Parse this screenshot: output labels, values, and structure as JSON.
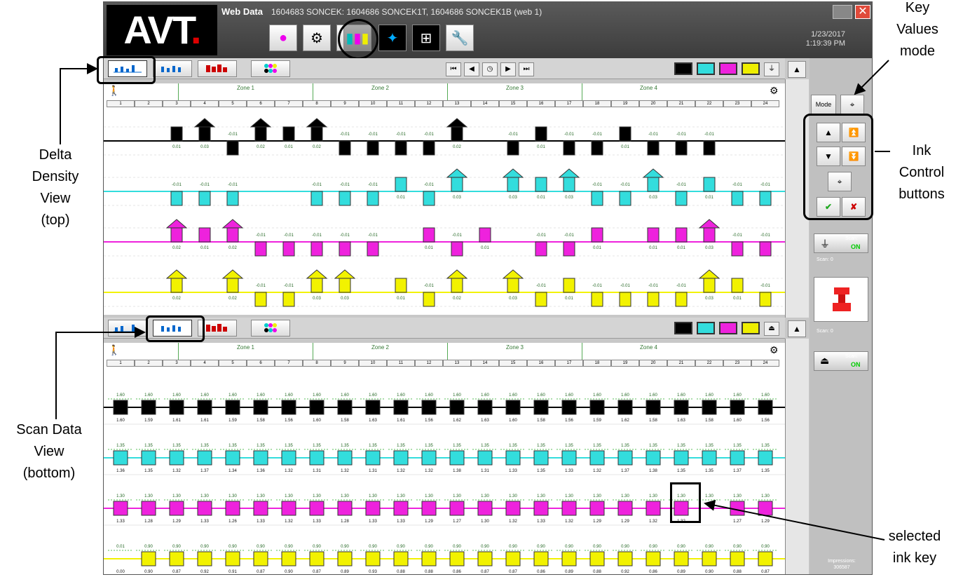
{
  "window": {
    "app_name": "Web Data",
    "job_title": "1604683 SONCEK: 1604686 SONCEK1T, 1604686 SONCEK1B  (web 1)",
    "date": "1/23/2017",
    "time": "1:19:39 PM",
    "logo": "AVT."
  },
  "toolbar_icons": [
    "colors-icon",
    "settings-icon",
    "monitor-icon",
    "chart-icon",
    "network-icon",
    "register-icon",
    "tools-icon"
  ],
  "zones": [
    "Zone 1",
    "Zone 2",
    "Zone 3",
    "Zone 4"
  ],
  "keys": [
    "1",
    "2",
    "3",
    "4",
    "5",
    "6",
    "7",
    "8",
    "9",
    "10",
    "11",
    "12",
    "13",
    "14",
    "15",
    "16",
    "17",
    "18",
    "19",
    "20",
    "21",
    "22",
    "23",
    "24"
  ],
  "side_panel": {
    "mode_label": "Mode",
    "scan_label": "Scan:",
    "scan_on": "ON",
    "scan_count_1": "Scan: 0",
    "scan_count_2": "Scan: 0",
    "impressions_label": "Impressions:",
    "impressions_value": "306587"
  },
  "annotations": {
    "key_values_mode": "Key\nValues\nmode",
    "ink_control": "Ink\nControl\nbuttons",
    "delta_density": "Delta\nDensity\nView\n(top)",
    "scan_data": "Scan Data\nView\n(bottom)",
    "selected_key": "selected\nink key"
  },
  "colors": {
    "black": "#000000",
    "cyan": "#33dddd",
    "magenta": "#ee22dd",
    "yellow": "#f2f200",
    "check": "#22aa22"
  },
  "delta_density": {
    "black": [
      "",
      "",
      "0.01",
      "0.03",
      "-0.01",
      "0.02",
      "0.01",
      "0.02",
      "-0.01",
      "-0.01",
      "-0.01",
      "-0.01",
      "0.02",
      "",
      "-0.01",
      "0.01",
      "-0.01",
      "-0.01",
      "0.01",
      "-0.01",
      "-0.01",
      "-0.01",
      "",
      ""
    ],
    "cyan": [
      "",
      "",
      "-0.01",
      "-0.01",
      "-0.01",
      "",
      "",
      "-0.01",
      "-0.01",
      "-0.01",
      "0.01",
      "-0.01",
      "0.03",
      "",
      "0.03",
      "0.01",
      "0.03",
      "-0.01",
      "-0.01",
      "0.03",
      "-0.01",
      "0.01",
      "-0.01",
      "-0.01"
    ],
    "magenta": [
      "",
      "",
      "0.02",
      "0.01",
      "0.02",
      "-0.01",
      "-0.01",
      "-0.01",
      "-0.01",
      "-0.01",
      "",
      "0.01",
      "-0.01",
      "0.01",
      "",
      "-0.01",
      "-0.01",
      "0.01",
      "",
      "0.01",
      "0.01",
      "0.03",
      "-0.01",
      "-0.01"
    ],
    "yellow": [
      "",
      "",
      "0.02",
      "",
      "0.02",
      "-0.01",
      "-0.01",
      "0.03",
      "0.03",
      "",
      "0.01",
      "-0.01",
      "0.02",
      "",
      "0.03",
      "-0.01",
      "0.01",
      "-0.01",
      "-0.01",
      "-0.01",
      "-0.01",
      "0.03",
      "0.01",
      "-0.01",
      "0.03",
      ""
    ]
  },
  "scan_data": {
    "black_target": "1.60",
    "black": [
      "1.60",
      "1.59",
      "1.61",
      "1.61",
      "1.59",
      "1.58",
      "1.56",
      "1.60",
      "1.58",
      "1.63",
      "1.61",
      "1.56",
      "1.62",
      "1.63",
      "1.60",
      "1.58",
      "1.56",
      "1.59",
      "1.62",
      "1.58",
      "1.63",
      "1.58",
      "1.60",
      "1.56"
    ],
    "cyan_target": "1.35",
    "cyan": [
      "1.36",
      "1.35",
      "1.32",
      "1.37",
      "1.34",
      "1.36",
      "1.32",
      "1.31",
      "1.32",
      "1.31",
      "1.32",
      "1.32",
      "1.38",
      "1.31",
      "1.33",
      "1.35",
      "1.33",
      "1.32",
      "1.37",
      "1.38",
      "1.35",
      "1.35",
      "1.37",
      "1.35"
    ],
    "magenta_target": "1.30",
    "magenta": [
      "1.33",
      "1.28",
      "1.29",
      "1.33",
      "1.26",
      "1.33",
      "1.32",
      "1.33",
      "1.28",
      "1.33",
      "1.33",
      "1.29",
      "1.27",
      "1.30",
      "1.32",
      "1.33",
      "1.32",
      "1.29",
      "1.29",
      "1.32",
      "1.32",
      "",
      "1.27",
      "1.29"
    ],
    "yellow_target": "0.90",
    "yellow_first_target": "0.01",
    "yellow": [
      "0.00",
      "0.90",
      "0.87",
      "0.92",
      "0.91",
      "0.87",
      "0.90",
      "0.87",
      "0.89",
      "0.93",
      "0.88",
      "0.88",
      "0.86",
      "0.87",
      "0.87",
      "0.86",
      "0.89",
      "0.88",
      "0.92",
      "0.86",
      "0.89",
      "0.90",
      "0.88",
      "0.87"
    ]
  }
}
